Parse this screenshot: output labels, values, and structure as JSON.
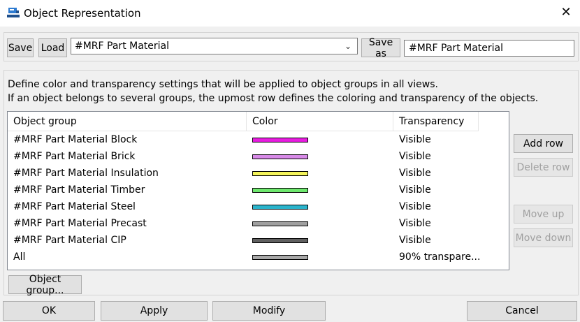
{
  "window": {
    "title": "Object Representation",
    "icon": "app-logo-icon",
    "close_icon": "close-icon"
  },
  "toolbar": {
    "save_label": "Save",
    "load_label": "Load",
    "selected_setting": "#MRF Part Material",
    "save_as_label": "Save as",
    "save_as_value": "#MRF Part Material"
  },
  "description": {
    "line1": "Define color and transparency settings that will be applied to object groups in all views.",
    "line2": "If an object belongs to several groups, the upmost row defines the coloring and transparency of the objects."
  },
  "table": {
    "headers": {
      "group": "Object group",
      "color": "Color",
      "transparency": "Transparency"
    },
    "rows": [
      {
        "group": "#MRF Part Material Block",
        "color": "#e81ce0",
        "transparency": "Visible"
      },
      {
        "group": "#MRF Part Material Brick",
        "color": "#d88ae8",
        "transparency": "Visible"
      },
      {
        "group": "#MRF Part Material Insulation",
        "color": "#f4f45a",
        "transparency": "Visible"
      },
      {
        "group": "#MRF Part Material Timber",
        "color": "#6ee86e",
        "transparency": "Visible"
      },
      {
        "group": "#MRF Part Material Steel",
        "color": "#2ab4cc",
        "transparency": "Visible"
      },
      {
        "group": "#MRF Part Material Precast",
        "color": "#a0a0a0",
        "transparency": "Visible"
      },
      {
        "group": "#MRF Part Material CIP",
        "color": "#606060",
        "transparency": "Visible"
      },
      {
        "group": "All",
        "color": "#a8a8a8",
        "transparency": "90% transpare..."
      }
    ]
  },
  "side_buttons": {
    "add_row": "Add row",
    "delete_row": "Delete row",
    "move_up": "Move up",
    "move_down": "Move down"
  },
  "object_group_button": "Object group...",
  "footer": {
    "ok": "OK",
    "apply": "Apply",
    "modify": "Modify",
    "cancel": "Cancel"
  }
}
